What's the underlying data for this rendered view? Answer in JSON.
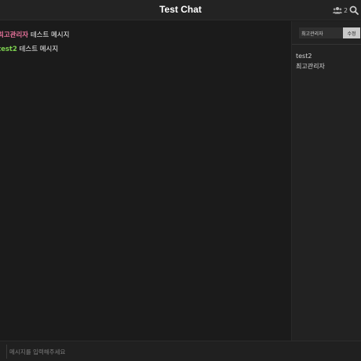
{
  "header": {
    "title": "Test Chat",
    "user_count": "2",
    "icons": {
      "users": "users-icon",
      "search": "search-icon"
    }
  },
  "messages": [
    {
      "name": "최고관리자",
      "name_color": "#e8739c",
      "text": "테스트 메시지"
    },
    {
      "name": "test2",
      "name_color": "#7ccf4f",
      "text": "테스트 메시지"
    }
  ],
  "sidebar": {
    "nickname_value": "최고관리자",
    "edit_button_label": "수정",
    "users": [
      "test2",
      "최고관리자"
    ]
  },
  "composer": {
    "placeholder": "메시지를 입력해주세요"
  }
}
